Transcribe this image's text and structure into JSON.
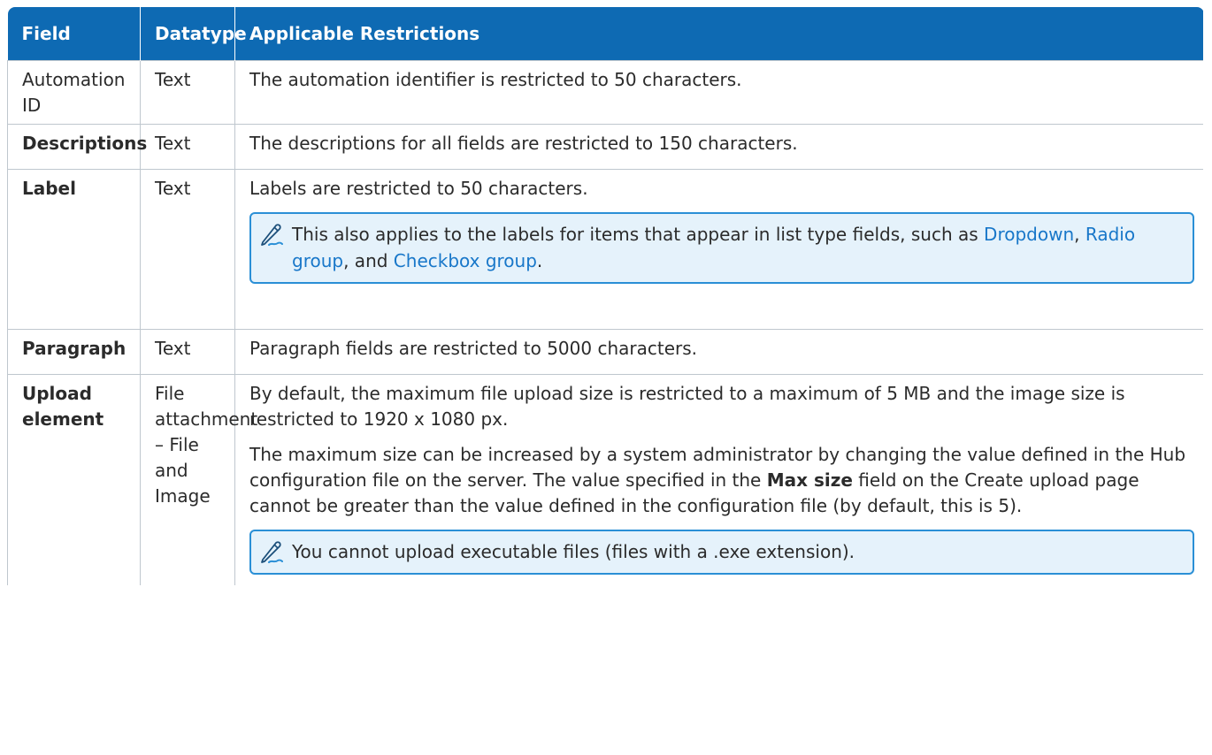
{
  "table": {
    "headers": [
      "Field",
      "Datatype",
      "Applicable Restrictions"
    ],
    "rows": [
      {
        "field": "Automation ID",
        "datatype": "Text",
        "restriction": "The automation identifier is restricted to 50 characters."
      },
      {
        "field": "Descriptions",
        "datatype": "Text",
        "restriction": "The descriptions for all fields are restricted to 150 characters."
      },
      {
        "field": "Label",
        "datatype": "Text",
        "restriction": "Labels are restricted to 50 characters.",
        "note": {
          "text_before": "This also applies to the labels for items that appear in list type fields, such as ",
          "link1": "Dropdown",
          "sep1": ", ",
          "link2": "Radio group",
          "sep2": ", and ",
          "link3": "Checkbox group",
          "text_after": "."
        }
      },
      {
        "field": "Paragraph",
        "datatype": "Text",
        "restriction": "Paragraph fields are restricted to 5000 characters."
      },
      {
        "field": "Upload element",
        "datatype": "File attachment – File and Image",
        "restriction": "By default, the maximum file upload size is restricted to a maximum of 5 MB and the image size is restricted to 1920 x 1080 px.",
        "restriction2_before": "The maximum size can be increased by a system administrator by changing the value defined in the Hub configuration file on the server. The value specified in the ",
        "restriction2_bold": "Max size",
        "restriction2_after": " field on the Create upload page cannot be greater than the value defined in the configuration file (by default, this is 5).",
        "note": {
          "text": "You cannot upload executable files (files with a .exe extension)."
        }
      }
    ]
  },
  "icons": {
    "note_icon": "pencil-note-icon"
  },
  "colors": {
    "header_bg": "#0e6ab3",
    "note_border": "#2a8fd6",
    "note_bg": "#e5f2fb",
    "link": "#1877c9"
  }
}
